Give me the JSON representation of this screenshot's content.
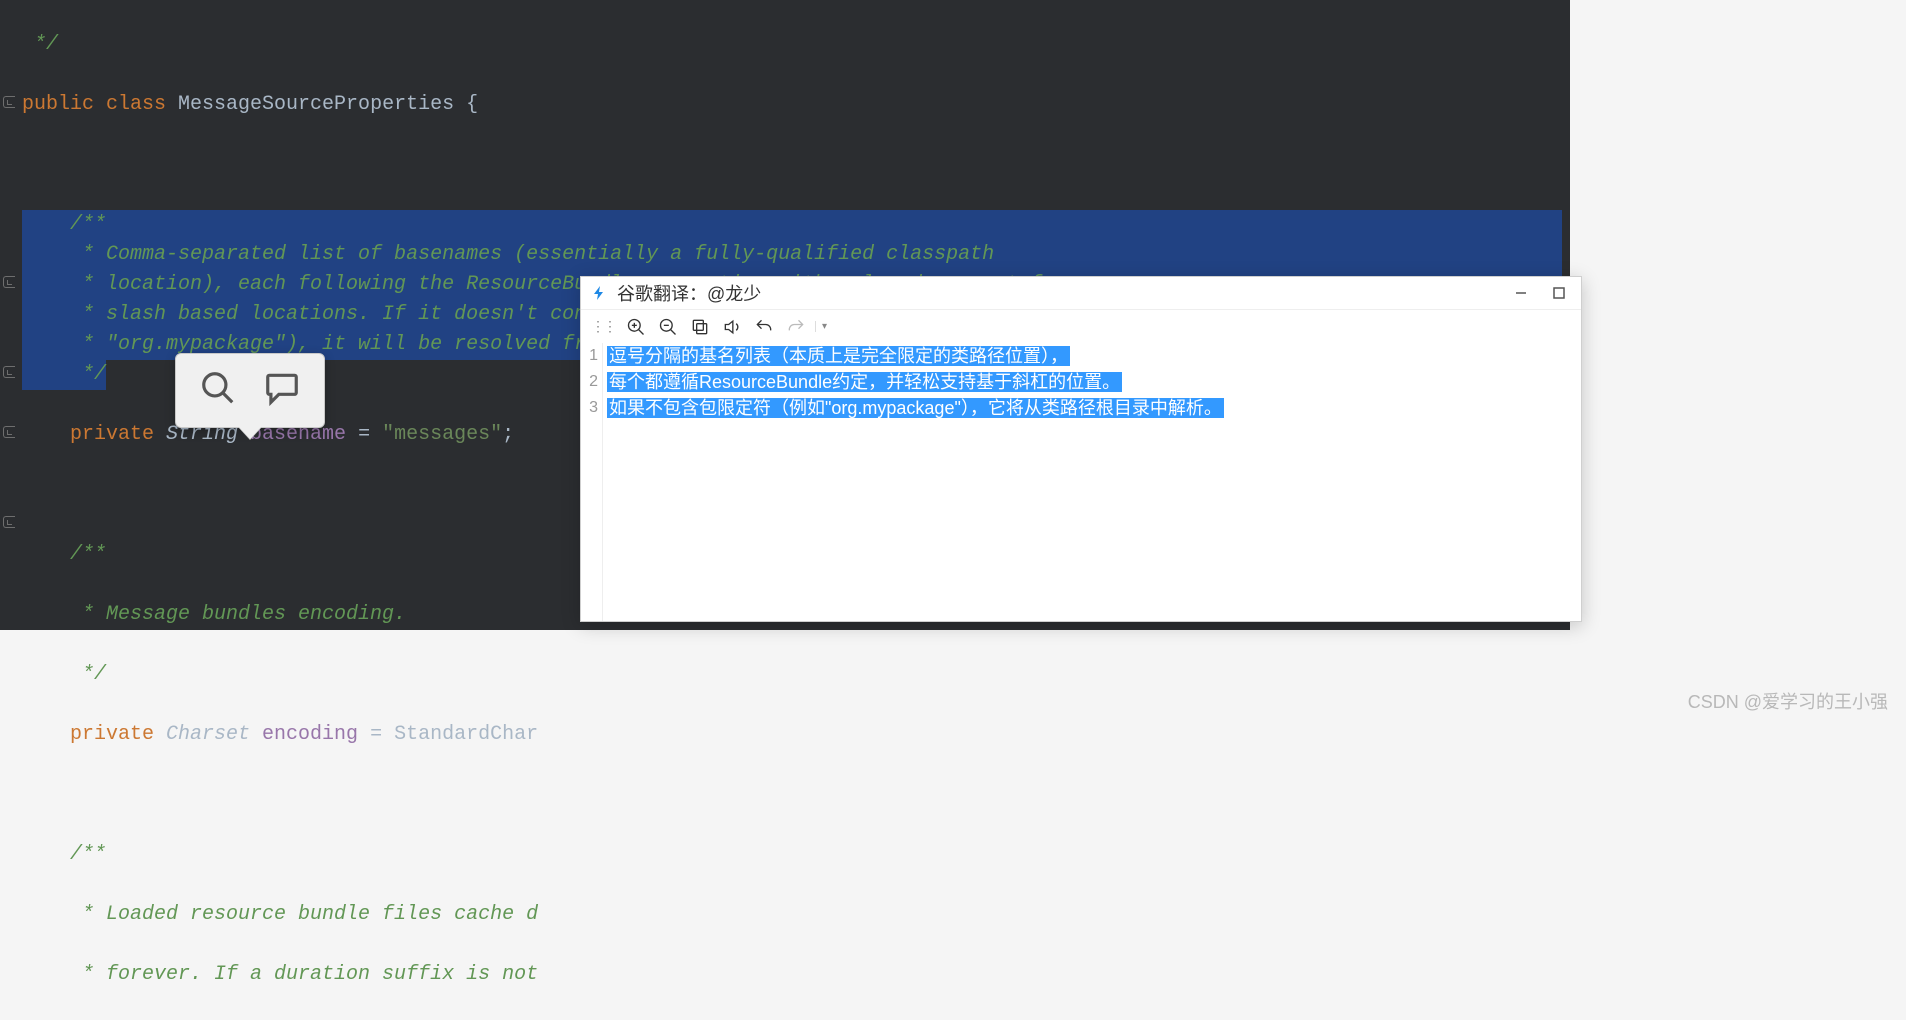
{
  "code": {
    "l1": " */",
    "l2_public": "public ",
    "l2_class": "class ",
    "l2_name": "MessageSourceProperties ",
    "l2_brace": "{",
    "c_open": "    /**",
    "c1": "     * Comma-separated list of basenames (essentially a fully-qualified classpath",
    "c2": "     * location), each following the ResourceBundle convention with relaxed support for",
    "c3": "     * slash based locations. If it doesn't contain a package qualifier (such as",
    "c4": "     * \"org.mypackage\"), it will be resolved from the classpath root.",
    "c_close": "     */",
    "f1_priv": "    private ",
    "f1_type": "String ",
    "f1_name": "basename",
    "f1_eq": " = ",
    "f1_val": "\"messages\"",
    "f1_semi": ";",
    "c2_open": "    /**",
    "c2_body": "     * Message bundles encoding.",
    "c2_close": "     */",
    "f2_priv": "    private ",
    "f2_type": "Charset ",
    "f2_name": "encoding",
    "f2_eq": " = ",
    "f2_rest": "StandardChar",
    "c3_open": "    /**",
    "c3_l1": "     * Loaded resource bundle files cache d",
    "c3_l2": "     * forever. If a duration suffix is not"
  },
  "translate": {
    "title": "谷歌翻译：@龙少",
    "lines": [
      "逗号分隔的基名列表（本质上是完全限定的类路径位置），",
      "每个都遵循ResourceBundle约定，并轻松支持基于斜杠的位置。",
      "如果不包含包限定符（例如\"org.mypackage\"），它将从类路径根目录中解析。"
    ]
  },
  "watermark": "CSDN @爱学习的王小强"
}
